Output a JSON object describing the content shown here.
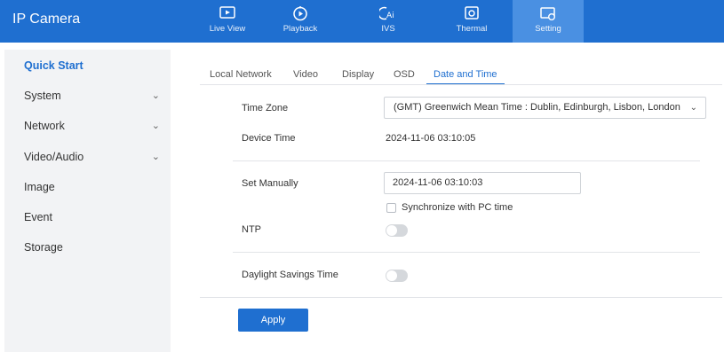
{
  "header": {
    "title": "IP Camera",
    "nav": [
      {
        "label": "Live View",
        "icon": "live-view-icon"
      },
      {
        "label": "Playback",
        "icon": "playback-icon"
      },
      {
        "label": "IVS",
        "icon": "ivs-icon"
      },
      {
        "label": "Thermal",
        "icon": "thermal-icon"
      },
      {
        "label": "Setting",
        "icon": "setting-icon"
      }
    ],
    "active_nav": "Setting"
  },
  "sidebar": {
    "items": [
      {
        "label": "Quick Start",
        "active": true
      },
      {
        "label": "System",
        "expandable": true
      },
      {
        "label": "Network",
        "expandable": true
      },
      {
        "label": "Video/Audio",
        "expandable": true
      },
      {
        "label": "Image"
      },
      {
        "label": "Event"
      },
      {
        "label": "Storage"
      }
    ]
  },
  "tabs": {
    "items": [
      "Local Network",
      "Video",
      "Display",
      "OSD",
      "Date and Time"
    ],
    "active": "Date and Time"
  },
  "form": {
    "time_zone_label": "Time Zone",
    "time_zone_value": "(GMT) Greenwich Mean Time : Dublin, Edinburgh, Lisbon, London",
    "device_time_label": "Device Time",
    "device_time_value": "2024-11-06 03:10:05",
    "set_manually_label": "Set Manually",
    "set_manually_value": "2024-11-06 03:10:03",
    "sync_pc_label": "Synchronize with PC time",
    "sync_pc_checked": false,
    "ntp_label": "NTP",
    "ntp_enabled": false,
    "dst_label": "Daylight Savings Time",
    "dst_enabled": false
  },
  "actions": {
    "apply_label": "Apply"
  },
  "colors": {
    "accent": "#1f6fd0",
    "active_nav_bg": "#4a90e2",
    "sidebar_bg": "#f2f3f5"
  }
}
